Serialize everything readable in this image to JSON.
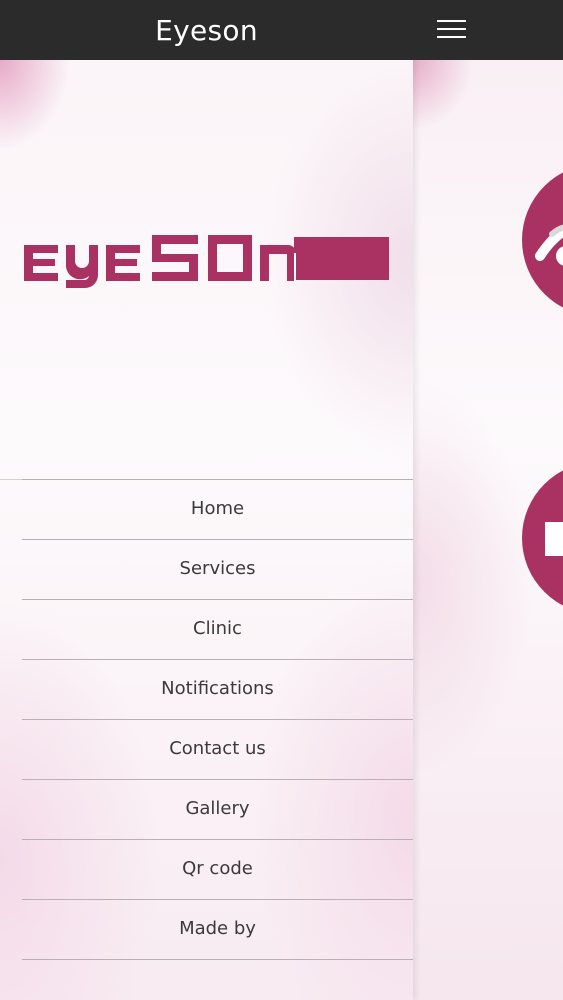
{
  "header": {
    "title": "Eyeson",
    "menu_icon": "hamburger-menu-icon"
  },
  "drawer": {
    "logo_text": "EYESON",
    "nav_items": [
      {
        "label": "Home"
      },
      {
        "label": "Services"
      },
      {
        "label": "Clinic"
      },
      {
        "label": "Notifications"
      },
      {
        "label": "Contact us"
      },
      {
        "label": "Gallery"
      },
      {
        "label": "Qr code"
      },
      {
        "label": "Made by"
      }
    ]
  },
  "content": {
    "tiles": [
      {
        "icon": "eye-icon"
      },
      {
        "icon": "clinic-icon"
      }
    ]
  },
  "colors": {
    "brand": "#a93262",
    "topbar": "#2b2b2b",
    "nav_text": "#3a3a3a",
    "divider": "#b9b0b4"
  }
}
